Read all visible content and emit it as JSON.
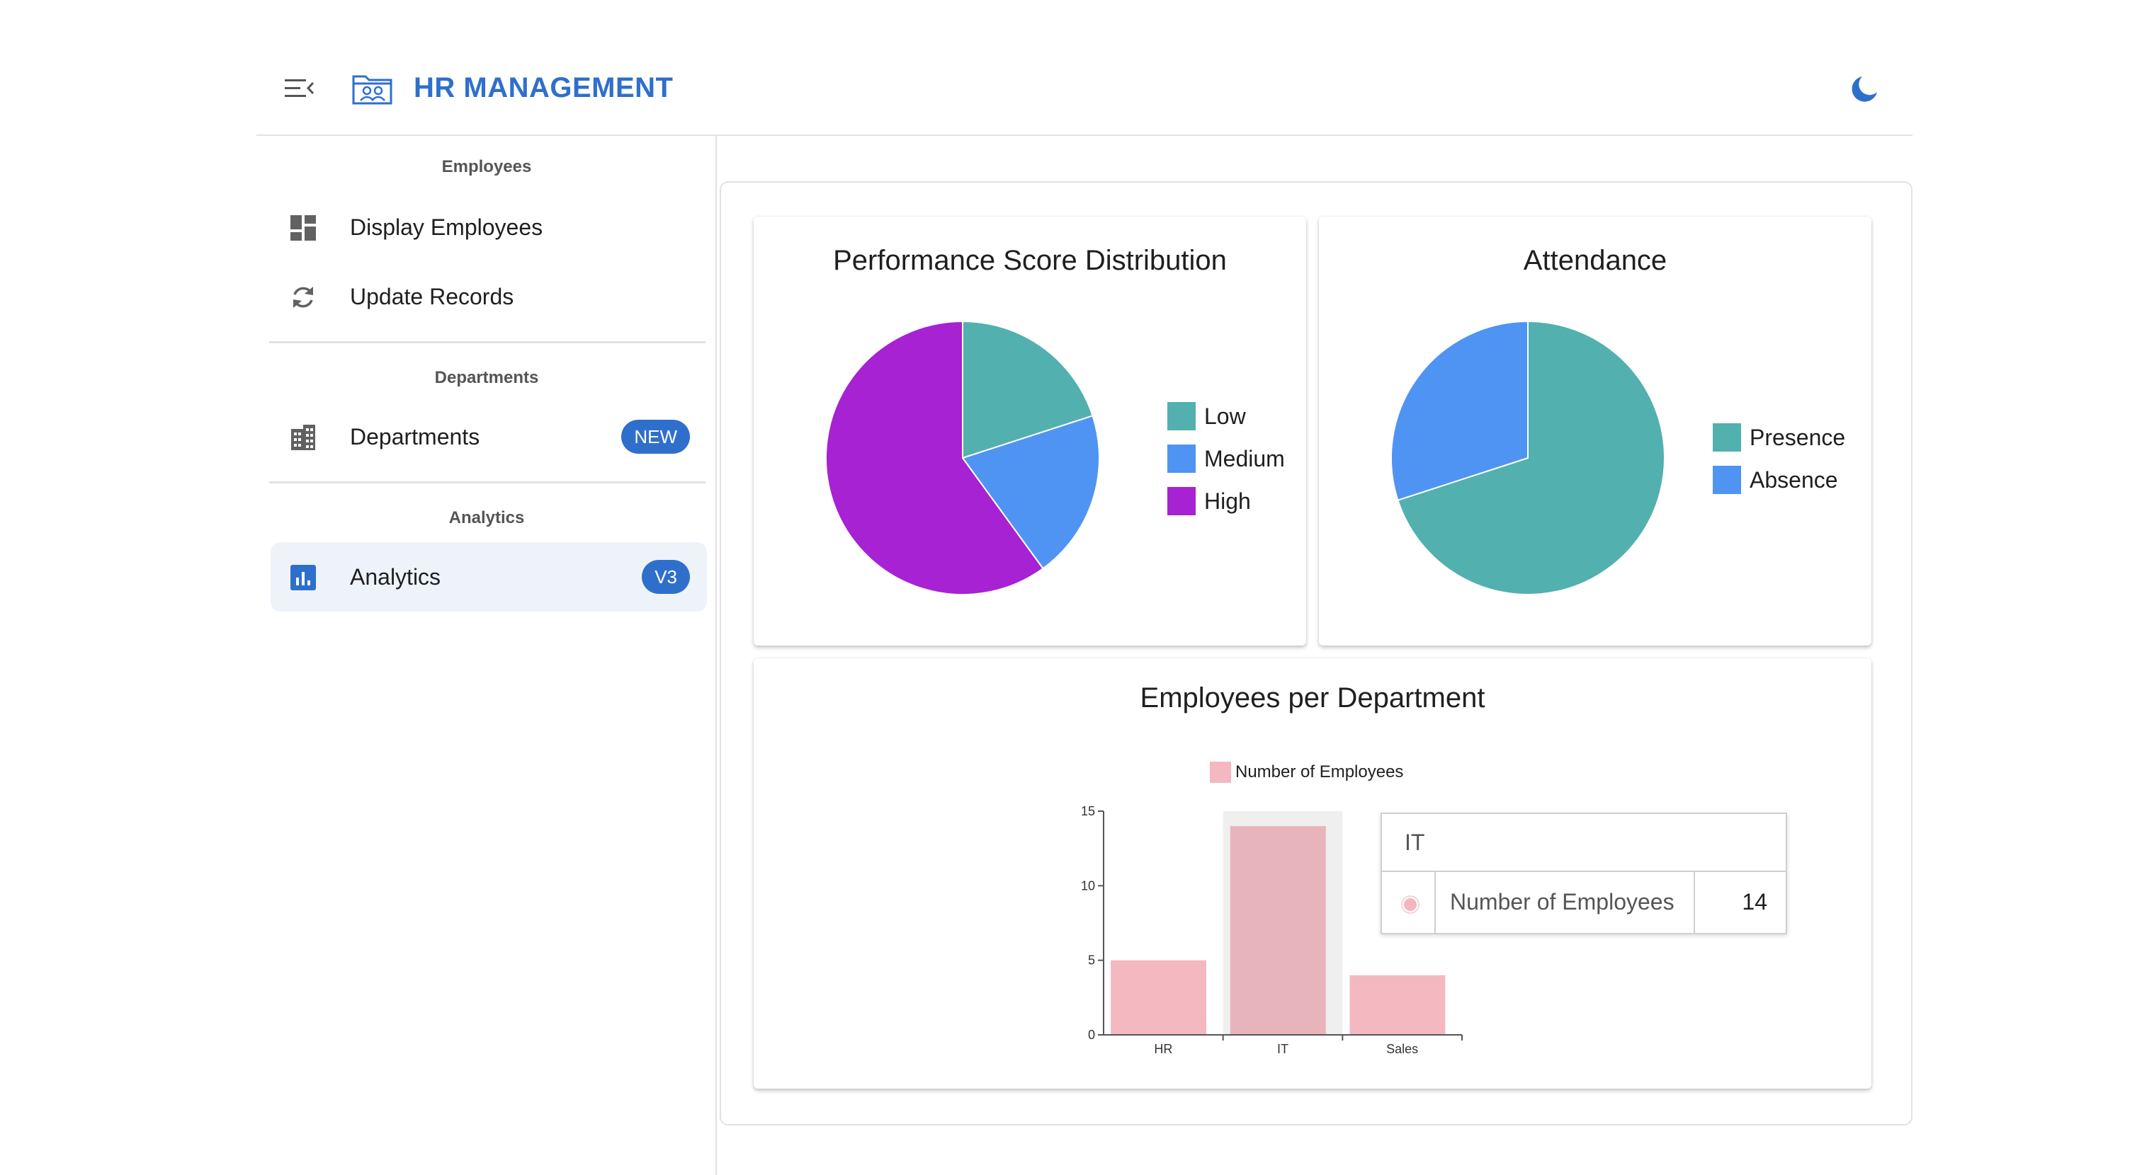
{
  "header": {
    "title": "HR MANAGEMENT",
    "menu_icon": "menu-collapse-icon",
    "brand_icon": "folder-people-icon",
    "theme_icon": "moon-icon"
  },
  "sidebar": {
    "sections": [
      {
        "title": "Employees",
        "items": [
          {
            "label": "Display Employees",
            "icon": "dashboard-icon"
          },
          {
            "label": "Update Records",
            "icon": "refresh-icon"
          }
        ]
      },
      {
        "title": "Departments",
        "items": [
          {
            "label": "Departments",
            "icon": "building-icon",
            "badge": "NEW"
          }
        ]
      },
      {
        "title": "Analytics",
        "items": [
          {
            "label": "Analytics",
            "icon": "bar-chart-icon",
            "badge": "V3",
            "active": true
          }
        ]
      }
    ]
  },
  "colors": {
    "accent": "#2f6fcc",
    "teal": "#52b0ae",
    "blue": "#4f94f2",
    "purple": "#a722d2",
    "pink": "#f4b8c0"
  },
  "chart_data": [
    {
      "type": "pie",
      "title": "Performance Score Distribution",
      "labels": [
        "Low",
        "Medium",
        "High"
      ],
      "values": [
        20,
        20,
        60
      ],
      "colors": [
        "#52b0ae",
        "#4f94f2",
        "#a722d2"
      ],
      "legend": "right"
    },
    {
      "type": "pie",
      "title": "Attendance",
      "labels": [
        "Presence",
        "Absence"
      ],
      "values": [
        70,
        30
      ],
      "colors": [
        "#52b0ae",
        "#4f94f2"
      ],
      "legend": "right"
    },
    {
      "type": "bar",
      "title": "Employees per Department",
      "categories": [
        "HR",
        "IT",
        "Sales"
      ],
      "series": [
        {
          "name": "Number of Employees",
          "values": [
            5,
            14,
            4
          ],
          "color": "#f4b8c0"
        }
      ],
      "ylim": [
        0,
        15
      ],
      "yticks": [
        0,
        5,
        10,
        15
      ],
      "legend": "top",
      "highlighted_category": "IT"
    }
  ],
  "tooltip": {
    "title": "IT",
    "series_name": "Number of Employees",
    "value": "14"
  }
}
